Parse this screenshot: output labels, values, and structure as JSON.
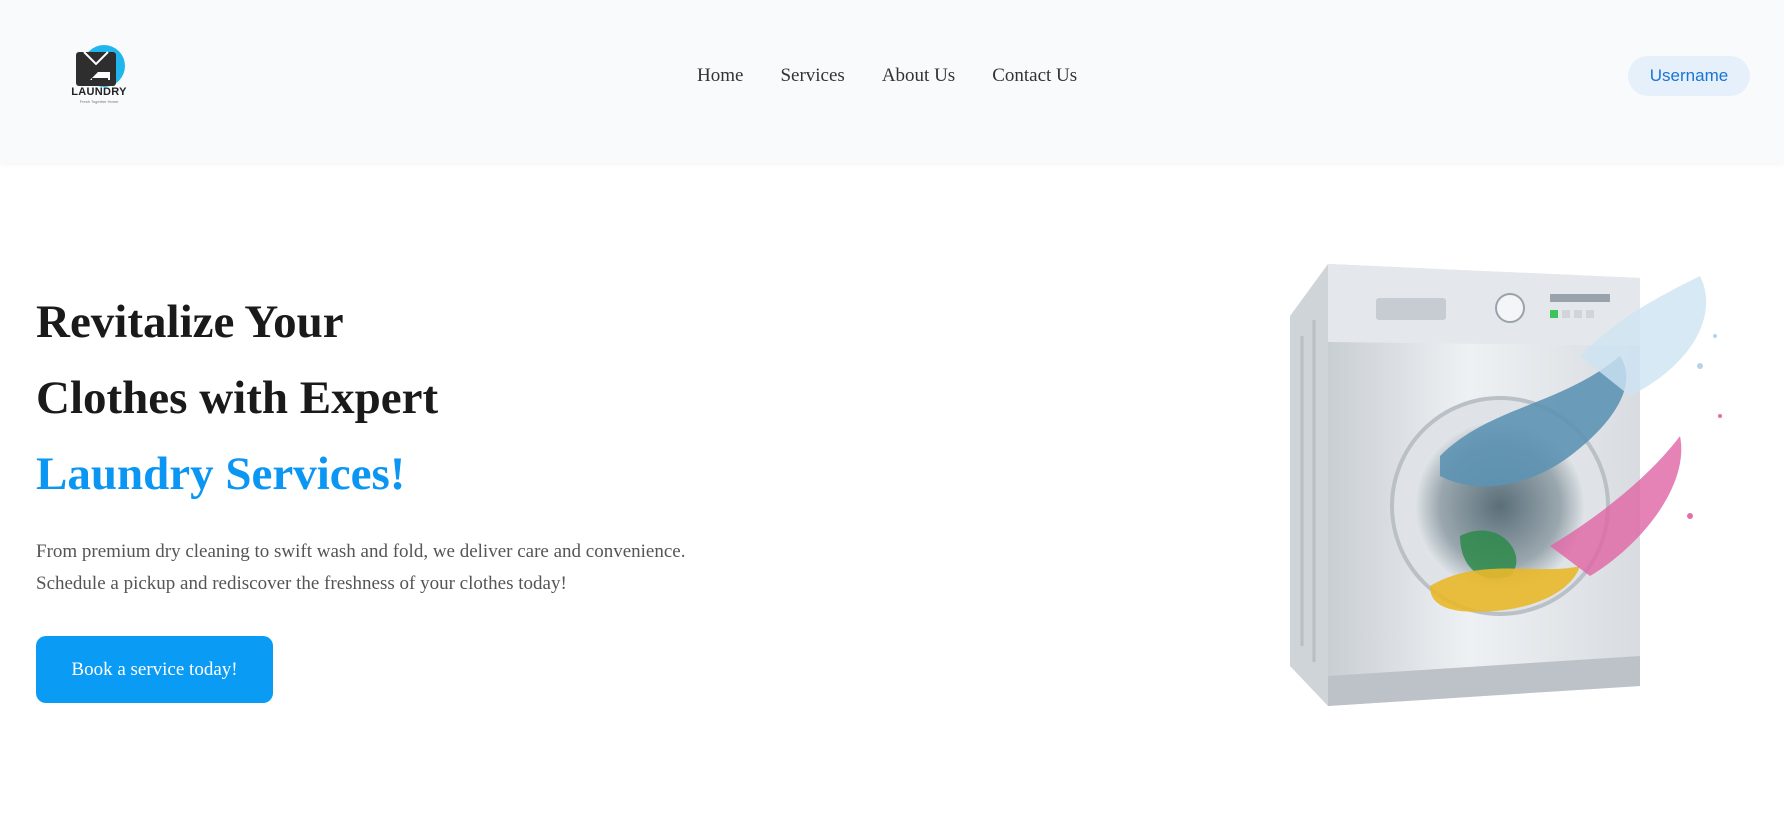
{
  "header": {
    "logo": {
      "name": "laundry-logo",
      "text": "LAUNDRY",
      "tagline": "Fresh Together Home"
    },
    "nav": [
      {
        "label": "Home"
      },
      {
        "label": "Services"
      },
      {
        "label": "About Us"
      },
      {
        "label": "Contact Us"
      }
    ],
    "user_button": "Username"
  },
  "hero": {
    "title_lines": [
      "Revitalize Your",
      "Clothes with Expert"
    ],
    "title_accent": "Laundry Services!",
    "description_lines": [
      "From premium dry cleaning to swift wash and fold, we deliver care and convenience.",
      "Schedule a pickup and rediscover the freshness of your clothes today!"
    ],
    "cta_label": "Book a service today!",
    "image": "washing-machine-with-colorful-splash"
  },
  "colors": {
    "accent": "#0a96f2",
    "cta_background": "#0a9bf5",
    "header_background": "#f9fafc",
    "user_button_background": "#e6f0fb",
    "user_button_text": "#1a74d4"
  }
}
